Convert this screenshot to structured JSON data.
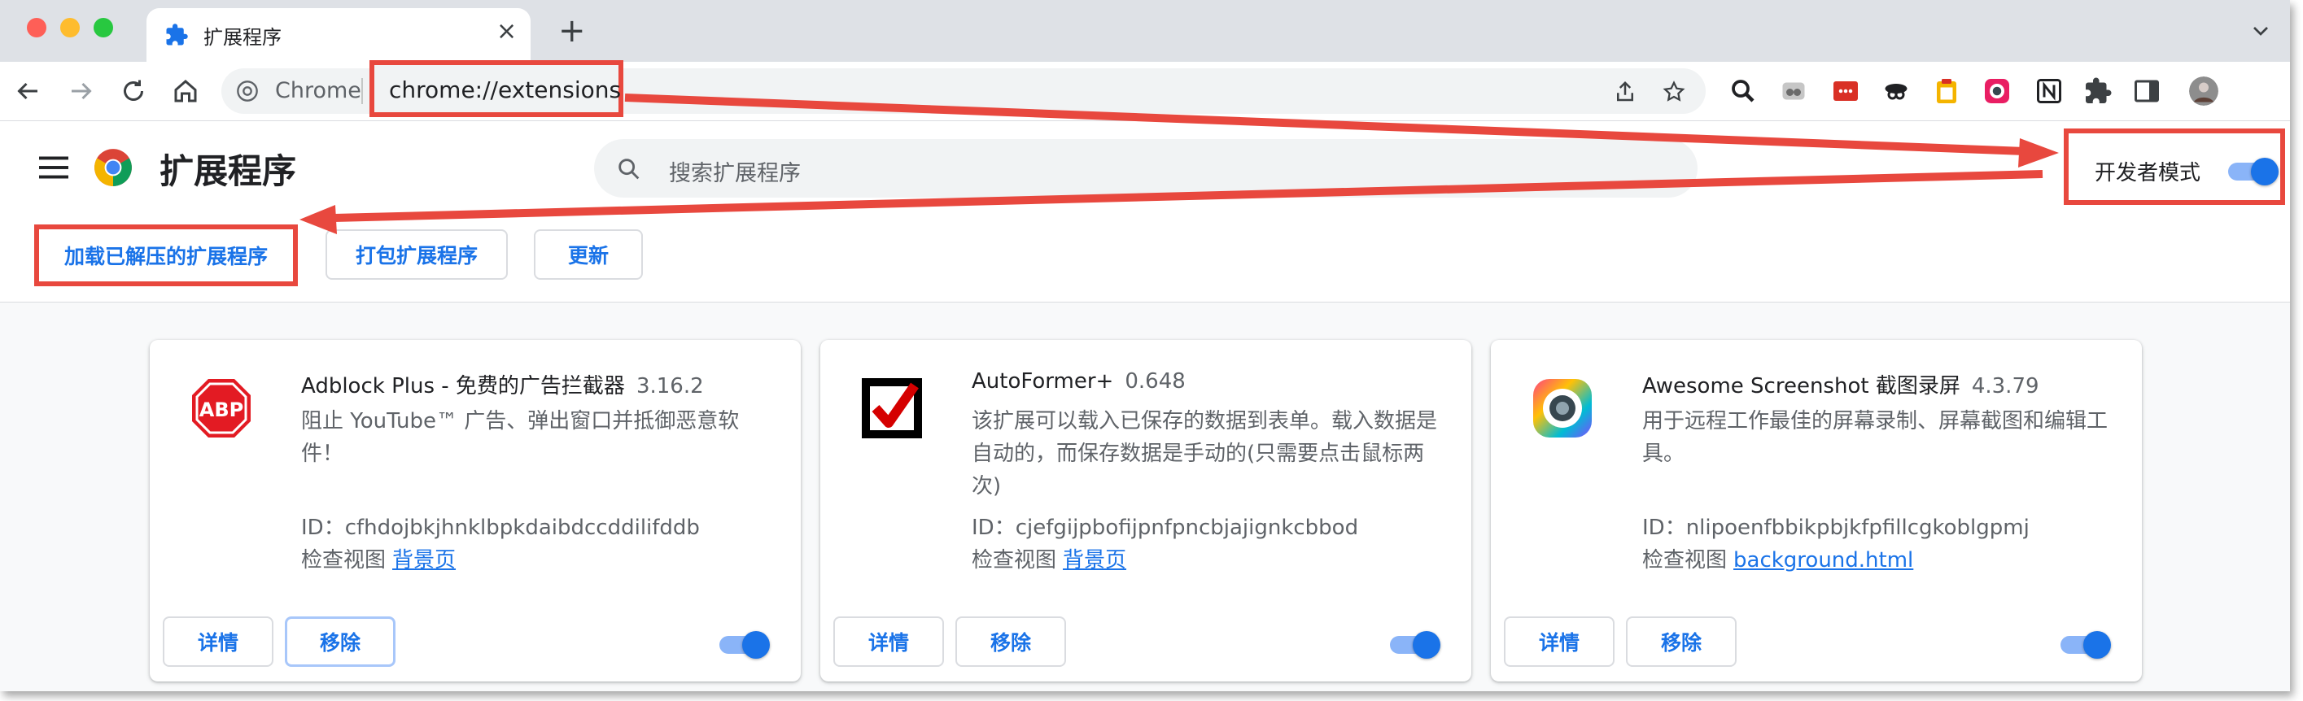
{
  "tab": {
    "title": "扩展程序",
    "close": "×",
    "new_tab": "+"
  },
  "toolbar": {
    "chip": "Chrome",
    "url": "chrome://extensions"
  },
  "header": {
    "title": "扩展程序",
    "search_placeholder": "搜索扩展程序",
    "dev_mode_label": "开发者模式",
    "dev_mode_on": true
  },
  "actions": {
    "load_unpacked": "加载已解压的扩展程序",
    "pack": "打包扩展程序",
    "update": "更新"
  },
  "extensions": [
    {
      "name": "Adblock Plus - 免费的广告拦截器",
      "version": "3.16.2",
      "description": "阻止 YouTube™ 广告、弹出窗口并抵御恶意软件！",
      "id": "ID：cfhdojbkjhnklbpkdaibdccddilifddb",
      "inspect_label": "检查视图",
      "inspect_link": "背景页",
      "details": "详情",
      "remove": "移除",
      "enabled": true
    },
    {
      "name": "AutoFormer+",
      "version": "0.648",
      "description": "该扩展可以载入已保存的数据到表单。载入数据是自动的，而保存数据是手动的(只需要点击鼠标两次)",
      "id": "ID：cjefgijpbofijpnfpncbjajignkcbbod",
      "inspect_label": "检查视图",
      "inspect_link": "背景页",
      "details": "详情",
      "remove": "移除",
      "enabled": true
    },
    {
      "name": "Awesome Screenshot 截图录屏",
      "version": "4.3.79",
      "description": "用于远程工作最佳的屏幕录制、屏幕截图和编辑工具。",
      "id": "ID：nlipoenfbbikpbjkfpfillcgkoblgpmj",
      "inspect_label": "检查视图",
      "inspect_link": "background.html",
      "details": "详情",
      "remove": "移除",
      "enabled": true
    }
  ],
  "colors": {
    "accent": "#1a73e8",
    "annotation": "#e8483e",
    "tabstrip": "#dee1e6"
  },
  "icons": [
    "back-icon",
    "forward-icon",
    "reload-icon",
    "home-icon",
    "share-icon",
    "bookmark-star-icon",
    "puzzle-icon",
    "side-panel-icon",
    "avatar"
  ]
}
